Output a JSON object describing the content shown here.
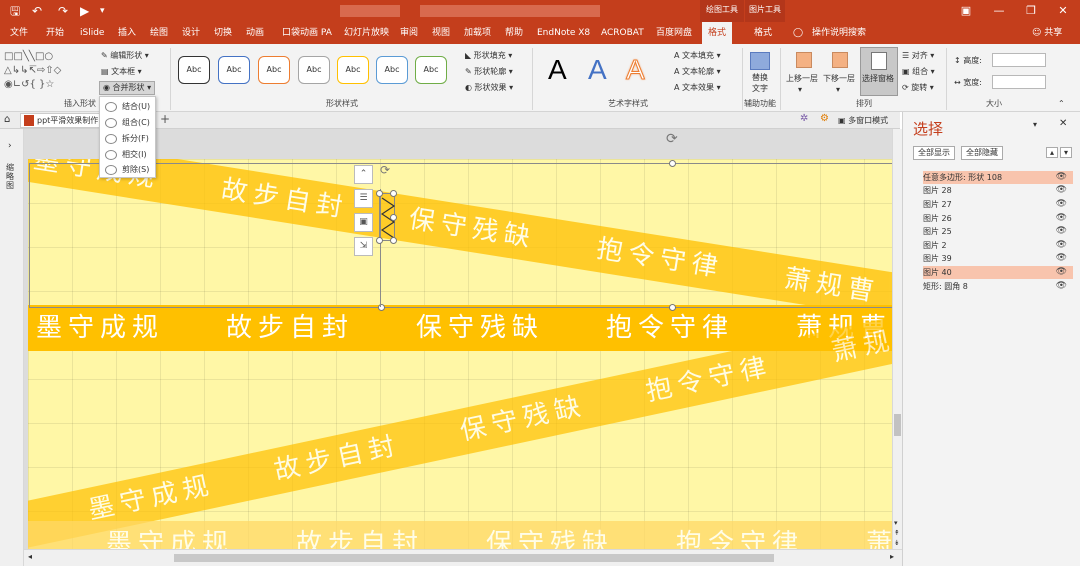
{
  "qat": {
    "save_icon": "save-icon",
    "undo_icon": "undo-icon",
    "redo_icon": "redo-icon",
    "present_icon": "present-icon"
  },
  "context_titles": {
    "drawing_tools": "绘图工具",
    "picture_tools": "图片工具"
  },
  "tabs": [
    "文件",
    "开始",
    "iSlide",
    "插入",
    "绘图",
    "设计",
    "切换",
    "动画",
    "口袋动画 PA",
    "幻灯片放映",
    "审阅",
    "视图",
    "加载项",
    "帮助",
    "EndNote X8",
    "ACROBAT",
    "百度网盘",
    "格式",
    "格式"
  ],
  "tell_me": "操作说明搜索",
  "share": "共享",
  "ribbon": {
    "insert_shapes": {
      "edit_shape": "编辑形状",
      "text_box": "文本框",
      "merge_shapes": "合并形状",
      "label": "插入形状"
    },
    "shape_styles": {
      "sample": "Abc",
      "fill": "形状填充",
      "outline": "形状轮廓",
      "effect": "形状效果",
      "label": "形状样式"
    },
    "wordart": {
      "letter": "A",
      "text_fill": "文本填充",
      "text_outline": "文本轮廓",
      "text_effect": "文本效果",
      "label": "艺术字样式"
    },
    "accessibility": {
      "alt_text_line1": "替换",
      "alt_text_line2": "文字",
      "label": "辅助功能"
    },
    "arrange": {
      "bring_forward": "上移一层",
      "send_backward": "下移一层",
      "selection_pane": "选择窗格",
      "align": "对齐",
      "group": "组合",
      "rotate": "旋转",
      "label": "排列"
    },
    "size": {
      "height_label": "高度:",
      "width_label": "宽度:",
      "label": "大小"
    }
  },
  "merge_menu": {
    "items": [
      "结合(U)",
      "组合(C)",
      "拆分(F)",
      "相交(I)",
      "剪除(S)"
    ]
  },
  "doc_tab": {
    "title": "ppt平滑效果制作"
  },
  "view_mode": "多窗口模式",
  "left_strip_label": "缩略图",
  "slide": {
    "words": [
      "墨守成规",
      "故步自封",
      "保守残缺",
      "抱令守律",
      "萧规曹"
    ],
    "band_color": "#ffc000",
    "band_light_color": "#ffd966"
  },
  "selection_pane": {
    "title": "选择",
    "show_all": "全部显示",
    "hide_all": "全部隐藏",
    "items": [
      {
        "label": "任意多边形: 形状 108",
        "selected": true
      },
      {
        "label": "图片 28",
        "selected": false
      },
      {
        "label": "图片 27",
        "selected": false
      },
      {
        "label": "图片 26",
        "selected": false
      },
      {
        "label": "图片 25",
        "selected": false
      },
      {
        "label": "图片 2",
        "selected": false
      },
      {
        "label": "图片 39",
        "selected": false
      },
      {
        "label": "图片 40",
        "selected": true
      },
      {
        "label": "矩形: 圆角 8",
        "selected": false
      }
    ]
  },
  "colors": {
    "accent": "#c43e1c",
    "selected_row": "#f8c4ad"
  }
}
